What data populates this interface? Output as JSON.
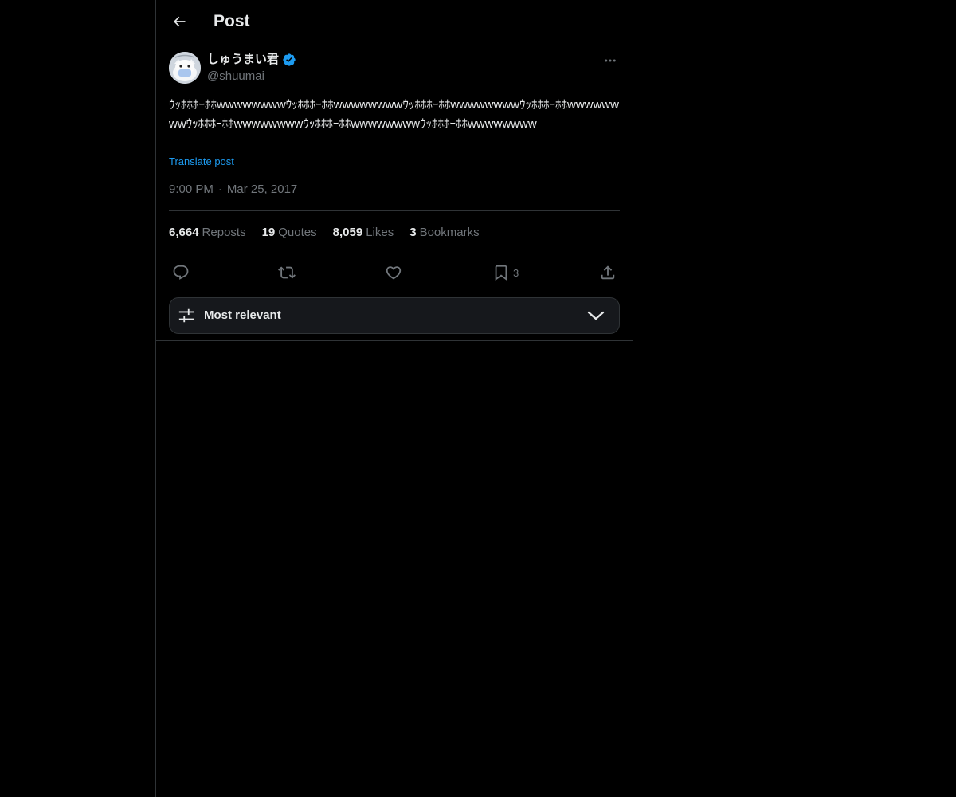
{
  "header": {
    "title": "Post",
    "back_icon": "arrow-left-icon"
  },
  "author": {
    "display_name": "しゅうまい君",
    "handle": "@shuumai",
    "verified": true,
    "verified_color": "#1d9bf0"
  },
  "post": {
    "text": "ｳｯﾎﾎﾎｰﾎﾎwwwwwwwwｳｯﾎﾎﾎｰﾎﾎwwwwwwwwｳｯﾎﾎﾎｰﾎﾎwwwwwwwwｳｯﾎﾎﾎｰﾎﾎwwwwwwwwｳｯﾎﾎﾎｰﾎﾎwwwwwwwwｳｯﾎﾎﾎｰﾎﾎwwwwwwwwｳｯﾎﾎﾎｰﾎﾎwwwwwwww",
    "translate_label": "Translate post",
    "time": "9:00 PM",
    "separator": "·",
    "date": "Mar 25, 2017"
  },
  "stats": {
    "reposts_count": "6,664",
    "reposts_label": "Reposts",
    "quotes_count": "19",
    "quotes_label": "Quotes",
    "likes_count": "8,059",
    "likes_label": "Likes",
    "bookmarks_count": "3",
    "bookmarks_label": "Bookmarks"
  },
  "actions": {
    "reply_icon": "reply-icon",
    "repost_icon": "repost-icon",
    "like_icon": "heart-icon",
    "bookmark_icon": "bookmark-icon",
    "bookmark_count": "3",
    "share_icon": "share-icon"
  },
  "replies_sort": {
    "label": "Most relevant",
    "icon": "filter-sliders-icon",
    "dropdown_icon": "chevron-down-icon"
  },
  "colors": {
    "background": "#000000",
    "text_primary": "#e7e9ea",
    "text_secondary": "#71767b",
    "accent": "#1d9bf0",
    "border": "#2f3336"
  }
}
